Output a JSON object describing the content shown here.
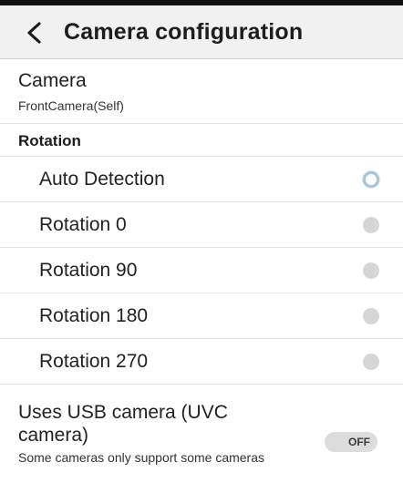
{
  "header": {
    "title": "Camera configuration",
    "back_icon": "chevron-left-icon"
  },
  "camera": {
    "title": "Camera",
    "value": "FrontCamera(Self)"
  },
  "rotation": {
    "section_title": "Rotation",
    "options": [
      {
        "label": "Auto Detection",
        "selected": true
      },
      {
        "label": "Rotation 0",
        "selected": false
      },
      {
        "label": "Rotation 90",
        "selected": false
      },
      {
        "label": "Rotation 180",
        "selected": false
      },
      {
        "label": "Rotation 270",
        "selected": false
      }
    ]
  },
  "usb": {
    "title": "Uses USB camera (UVC camera)",
    "subtitle": "Some cameras only support some cameras",
    "toggle_label": "OFF",
    "enabled": false
  },
  "colors": {
    "header_bg": "#f1f1f1",
    "radio_selected_ring": "#a8c4d6",
    "radio_unselected": "#d6d6d6",
    "toggle_off_bg": "#dcdcdc"
  }
}
